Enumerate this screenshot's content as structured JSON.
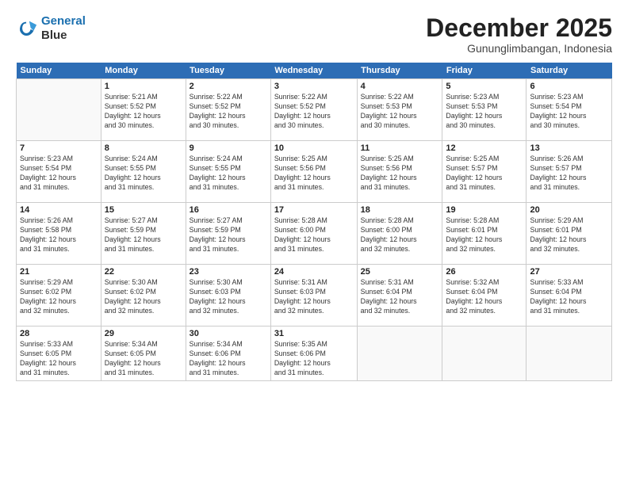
{
  "logo": {
    "line1": "General",
    "line2": "Blue"
  },
  "header": {
    "month_year": "December 2025",
    "location": "Gununglimbangan, Indonesia"
  },
  "days_of_week": [
    "Sunday",
    "Monday",
    "Tuesday",
    "Wednesday",
    "Thursday",
    "Friday",
    "Saturday"
  ],
  "weeks": [
    [
      {
        "day": "",
        "text": ""
      },
      {
        "day": "1",
        "text": "Sunrise: 5:21 AM\nSunset: 5:52 PM\nDaylight: 12 hours\nand 30 minutes."
      },
      {
        "day": "2",
        "text": "Sunrise: 5:22 AM\nSunset: 5:52 PM\nDaylight: 12 hours\nand 30 minutes."
      },
      {
        "day": "3",
        "text": "Sunrise: 5:22 AM\nSunset: 5:52 PM\nDaylight: 12 hours\nand 30 minutes."
      },
      {
        "day": "4",
        "text": "Sunrise: 5:22 AM\nSunset: 5:53 PM\nDaylight: 12 hours\nand 30 minutes."
      },
      {
        "day": "5",
        "text": "Sunrise: 5:23 AM\nSunset: 5:53 PM\nDaylight: 12 hours\nand 30 minutes."
      },
      {
        "day": "6",
        "text": "Sunrise: 5:23 AM\nSunset: 5:54 PM\nDaylight: 12 hours\nand 30 minutes."
      }
    ],
    [
      {
        "day": "7",
        "text": "Sunrise: 5:23 AM\nSunset: 5:54 PM\nDaylight: 12 hours\nand 31 minutes."
      },
      {
        "day": "8",
        "text": "Sunrise: 5:24 AM\nSunset: 5:55 PM\nDaylight: 12 hours\nand 31 minutes."
      },
      {
        "day": "9",
        "text": "Sunrise: 5:24 AM\nSunset: 5:55 PM\nDaylight: 12 hours\nand 31 minutes."
      },
      {
        "day": "10",
        "text": "Sunrise: 5:25 AM\nSunset: 5:56 PM\nDaylight: 12 hours\nand 31 minutes."
      },
      {
        "day": "11",
        "text": "Sunrise: 5:25 AM\nSunset: 5:56 PM\nDaylight: 12 hours\nand 31 minutes."
      },
      {
        "day": "12",
        "text": "Sunrise: 5:25 AM\nSunset: 5:57 PM\nDaylight: 12 hours\nand 31 minutes."
      },
      {
        "day": "13",
        "text": "Sunrise: 5:26 AM\nSunset: 5:57 PM\nDaylight: 12 hours\nand 31 minutes."
      }
    ],
    [
      {
        "day": "14",
        "text": "Sunrise: 5:26 AM\nSunset: 5:58 PM\nDaylight: 12 hours\nand 31 minutes."
      },
      {
        "day": "15",
        "text": "Sunrise: 5:27 AM\nSunset: 5:59 PM\nDaylight: 12 hours\nand 31 minutes."
      },
      {
        "day": "16",
        "text": "Sunrise: 5:27 AM\nSunset: 5:59 PM\nDaylight: 12 hours\nand 31 minutes."
      },
      {
        "day": "17",
        "text": "Sunrise: 5:28 AM\nSunset: 6:00 PM\nDaylight: 12 hours\nand 31 minutes."
      },
      {
        "day": "18",
        "text": "Sunrise: 5:28 AM\nSunset: 6:00 PM\nDaylight: 12 hours\nand 32 minutes."
      },
      {
        "day": "19",
        "text": "Sunrise: 5:28 AM\nSunset: 6:01 PM\nDaylight: 12 hours\nand 32 minutes."
      },
      {
        "day": "20",
        "text": "Sunrise: 5:29 AM\nSunset: 6:01 PM\nDaylight: 12 hours\nand 32 minutes."
      }
    ],
    [
      {
        "day": "21",
        "text": "Sunrise: 5:29 AM\nSunset: 6:02 PM\nDaylight: 12 hours\nand 32 minutes."
      },
      {
        "day": "22",
        "text": "Sunrise: 5:30 AM\nSunset: 6:02 PM\nDaylight: 12 hours\nand 32 minutes."
      },
      {
        "day": "23",
        "text": "Sunrise: 5:30 AM\nSunset: 6:03 PM\nDaylight: 12 hours\nand 32 minutes."
      },
      {
        "day": "24",
        "text": "Sunrise: 5:31 AM\nSunset: 6:03 PM\nDaylight: 12 hours\nand 32 minutes."
      },
      {
        "day": "25",
        "text": "Sunrise: 5:31 AM\nSunset: 6:04 PM\nDaylight: 12 hours\nand 32 minutes."
      },
      {
        "day": "26",
        "text": "Sunrise: 5:32 AM\nSunset: 6:04 PM\nDaylight: 12 hours\nand 32 minutes."
      },
      {
        "day": "27",
        "text": "Sunrise: 5:33 AM\nSunset: 6:04 PM\nDaylight: 12 hours\nand 31 minutes."
      }
    ],
    [
      {
        "day": "28",
        "text": "Sunrise: 5:33 AM\nSunset: 6:05 PM\nDaylight: 12 hours\nand 31 minutes."
      },
      {
        "day": "29",
        "text": "Sunrise: 5:34 AM\nSunset: 6:05 PM\nDaylight: 12 hours\nand 31 minutes."
      },
      {
        "day": "30",
        "text": "Sunrise: 5:34 AM\nSunset: 6:06 PM\nDaylight: 12 hours\nand 31 minutes."
      },
      {
        "day": "31",
        "text": "Sunrise: 5:35 AM\nSunset: 6:06 PM\nDaylight: 12 hours\nand 31 minutes."
      },
      {
        "day": "",
        "text": ""
      },
      {
        "day": "",
        "text": ""
      },
      {
        "day": "",
        "text": ""
      }
    ]
  ]
}
